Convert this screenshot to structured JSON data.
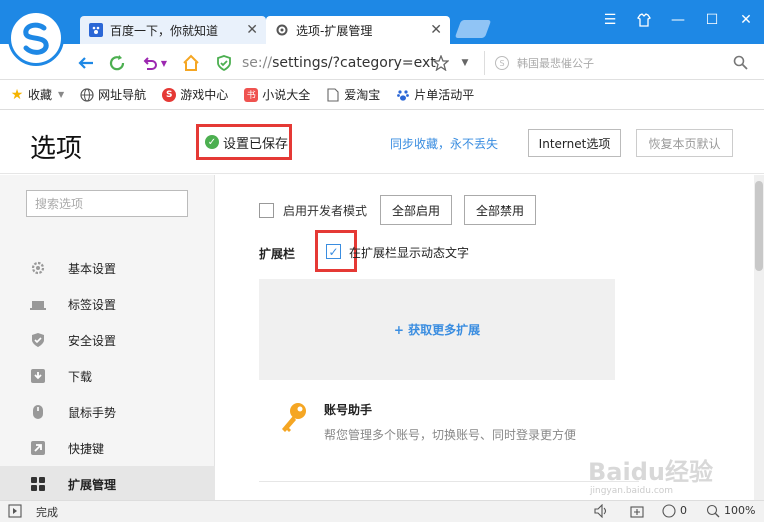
{
  "browser": {
    "tabs": [
      {
        "label": "百度一下，你就知道",
        "icon": "paw-icon"
      },
      {
        "label": "选项-扩展管理",
        "icon": "gear-icon"
      }
    ],
    "address": {
      "prefix": "se://",
      "path": "settings/?category=ext"
    },
    "search_placeholder": "韩国最悲催公子",
    "bookmarks": [
      {
        "label": "收藏",
        "icon": "star-icon"
      },
      {
        "label": "网址导航",
        "icon": "globe-icon"
      },
      {
        "label": "游戏中心",
        "icon": "game-icon"
      },
      {
        "label": "小说大全",
        "icon": "book-icon"
      },
      {
        "label": "爱淘宝",
        "icon": "page-icon"
      },
      {
        "label": "片单活动平",
        "icon": "paw-icon"
      }
    ],
    "status": {
      "text": "完成",
      "count": "0",
      "zoom": "100%"
    },
    "accent": "#1e88e5"
  },
  "header": {
    "title": "选项",
    "saved": "设置已保存",
    "sync": "同步收藏，永不丢失",
    "internet_btn": "Internet选项",
    "reset_btn": "恢复本页默认"
  },
  "sidebar": {
    "search_placeholder": "搜索选项",
    "items": [
      {
        "label": "基本设置",
        "icon": "gear-icon"
      },
      {
        "label": "标签设置",
        "icon": "tab-icon"
      },
      {
        "label": "安全设置",
        "icon": "shield-icon"
      },
      {
        "label": "下载",
        "icon": "download-icon"
      },
      {
        "label": "鼠标手势",
        "icon": "mouse-icon"
      },
      {
        "label": "快捷键",
        "icon": "shortcut-icon"
      },
      {
        "label": "扩展管理",
        "icon": "grid-icon"
      }
    ]
  },
  "main": {
    "dev_mode": "启用开发者模式",
    "enable_all": "全部启用",
    "disable_all": "全部禁用",
    "ext_bar_label": "扩展栏",
    "ext_bar_option": "在扩展栏显示动态文字",
    "get_more": "+ 获取更多扩展",
    "account_title": "账号助手",
    "account_desc": "帮您管理多个账号，切换账号、同时登录更方便"
  },
  "watermark": {
    "main": "Baidu经验",
    "sub": "jingyan.baidu.com"
  }
}
